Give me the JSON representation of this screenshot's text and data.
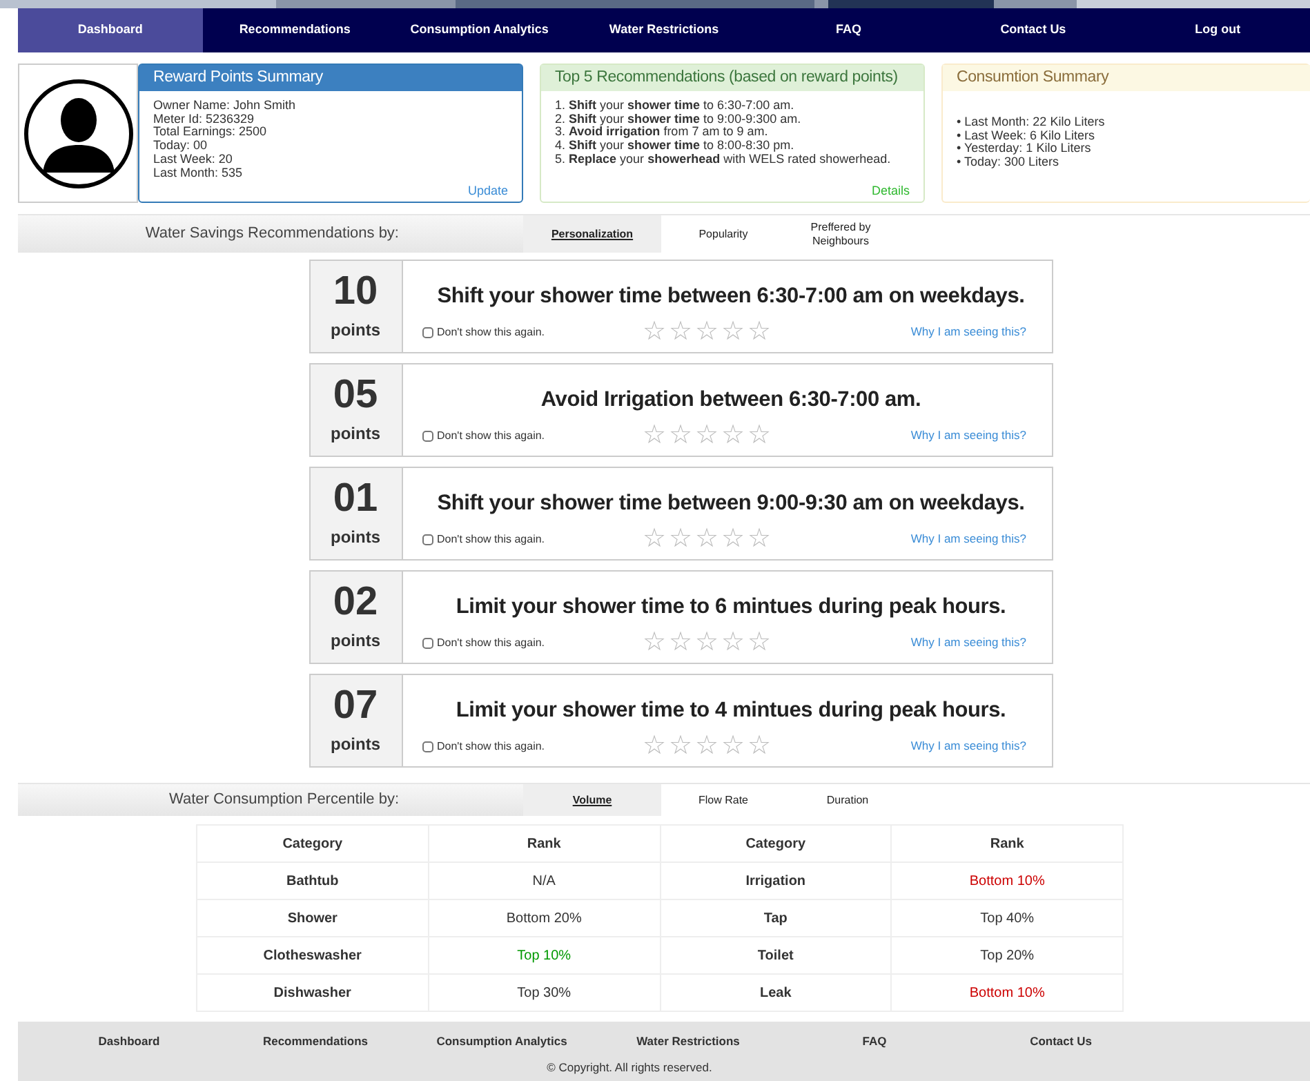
{
  "nav": [
    {
      "label": "Dashboard",
      "selected": true
    },
    {
      "label": "Recommendations",
      "selected": false
    },
    {
      "label": "Consumption Analytics",
      "selected": false
    },
    {
      "label": "Water Restrictions",
      "selected": false
    },
    {
      "label": "FAQ",
      "selected": false
    },
    {
      "label": "Contact Us",
      "selected": false
    },
    {
      "label": "Log out",
      "selected": false
    }
  ],
  "reward": {
    "title": "Reward Points Summary",
    "lines": [
      "Owner Name: John Smith",
      "Meter Id: 5236329",
      "Total Earnings: 2500",
      "Today: 00",
      "Last Week: 20",
      "Last Month: 535"
    ],
    "link": "Update"
  },
  "top5": {
    "title": "Top 5 Recommendations (based on reward points)",
    "items": [
      "1. **Shift** your **shower time** to 6:30-7:00 am.",
      "2. **Shift** your **shower time** to 9:00-9:300 am.",
      "3. **Avoid irrigation** from 7 am to 9 am.",
      "4. **Shift** your **shower time** to 8:00-8:30 pm.",
      "5. **Replace** your **showerhead** with WELS rated showerhead."
    ],
    "link": "Details"
  },
  "consumption": {
    "title": "Consumtion Summary",
    "items": [
      "• Last Month: 22 Kilo Liters",
      "• Last Week: 6 Kilo Liters",
      "• Yesterday: 1 Kilo Liters",
      "• Today: 300 Liters"
    ]
  },
  "savings": {
    "label": "Water Savings Recommendations by:",
    "tabs": [
      {
        "label": "Personalization",
        "selected": true
      },
      {
        "label": "Popularity",
        "selected": false
      },
      {
        "label": "Preffered by Neighbours",
        "selected": false
      }
    ],
    "cards": [
      {
        "points": "10",
        "unit": "points",
        "text": "Shift your shower time between 6:30-7:00 am on weekdays.",
        "checkbox_label": "Don't show this again.",
        "checked": false,
        "stars": 0,
        "link": "Why I am seeing this?"
      },
      {
        "points": "05",
        "unit": "points",
        "text": "Avoid Irrigation between 6:30-7:00 am.",
        "checkbox_label": "Don't show this again.",
        "checked": false,
        "stars": 0,
        "link": "Why I am seeing this?"
      },
      {
        "points": "01",
        "unit": "points",
        "text": "Shift your shower time between 9:00-9:30 am on weekdays.",
        "checkbox_label": "Don't show this again.",
        "checked": false,
        "stars": 0,
        "link": "Why I am seeing this?"
      },
      {
        "points": "02",
        "unit": "points",
        "text": "Limit your shower time to 6 mintues during peak hours.",
        "checkbox_label": "Don't show this again.",
        "checked": false,
        "stars": 0,
        "link": "Why I am seeing this?"
      },
      {
        "points": "07",
        "unit": "points",
        "text": "Limit your shower time to 4 mintues during peak hours.",
        "checkbox_label": "Don't show this again.",
        "checked": false,
        "stars": 0,
        "link": "Why I am seeing this?"
      }
    ]
  },
  "percentile": {
    "label": "Water Consumption Percentile by:",
    "tabs": [
      {
        "label": "Volume",
        "selected": true
      },
      {
        "label": "Flow Rate",
        "selected": false
      },
      {
        "label": "Duration",
        "selected": false
      }
    ],
    "columns": [
      "Category",
      "Rank",
      "Category",
      "Rank"
    ],
    "rows": [
      [
        {
          "text": "Bathtub",
          "kind": "category"
        },
        {
          "text": "N/A",
          "kind": "rank",
          "color": "#333333"
        },
        {
          "text": "Irrigation",
          "kind": "category"
        },
        {
          "text": "Bottom 10%",
          "kind": "rank",
          "color": "#cc0000"
        }
      ],
      [
        {
          "text": "Shower",
          "kind": "category"
        },
        {
          "text": "Bottom 20%",
          "kind": "rank",
          "color": "#333333"
        },
        {
          "text": "Tap",
          "kind": "category"
        },
        {
          "text": "Top 40%",
          "kind": "rank",
          "color": "#333333"
        }
      ],
      [
        {
          "text": "Clotheswasher",
          "kind": "category"
        },
        {
          "text": "Top 10%",
          "kind": "rank",
          "color": "#009900"
        },
        {
          "text": "Toilet",
          "kind": "category"
        },
        {
          "text": "Top 20%",
          "kind": "rank",
          "color": "#333333"
        }
      ],
      [
        {
          "text": "Dishwasher",
          "kind": "category"
        },
        {
          "text": "Top 30%",
          "kind": "rank",
          "color": "#333333"
        },
        {
          "text": "Leak",
          "kind": "category"
        },
        {
          "text": "Bottom 10%",
          "kind": "rank",
          "color": "#cc0000"
        }
      ]
    ]
  },
  "footer": {
    "links": [
      "Dashboard",
      "Recommendations",
      "Consumption Analytics",
      "Water Restrictions",
      "FAQ",
      "Contact Us"
    ],
    "copyright": "© Copyright. All rights reserved."
  }
}
